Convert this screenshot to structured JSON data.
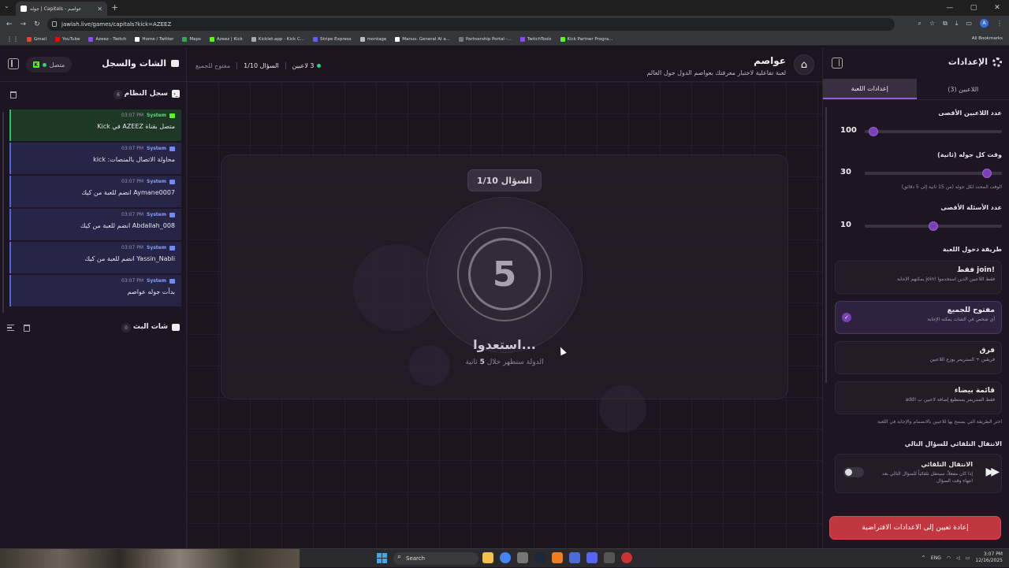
{
  "browser": {
    "tab_title": "جوله | Capitals - عواصم",
    "url": "jawlah.live/games/capitals?kick=AZEEZ",
    "bookmarks": [
      "Gmail",
      "YouTube",
      "Azeez - Twitch",
      "Home / Twitter",
      "Maps",
      "Azeez | Kick",
      "Kicklet.app - Kick C...",
      "Stripe Express",
      "montage",
      "Manus: General AI a...",
      "Partnership Portal -...",
      "TwitchTools",
      "Kick Partner Progra..."
    ],
    "all_bookmarks": "All Bookmarks",
    "avatar_letter": "A"
  },
  "left": {
    "title": "الشات والسجل",
    "connection": "متصل",
    "system_log_title": "سجل النظام",
    "system_log_count": "6",
    "logs": [
      {
        "source": "System",
        "time": "03:07 PM",
        "message": "متصل بقناة AZEEZ في Kick",
        "kind": "ok"
      },
      {
        "source": "System",
        "time": "03:07 PM",
        "message": "محاولة الاتصال بالمنصات: kick",
        "kind": "info"
      },
      {
        "source": "System",
        "time": "03:07 PM",
        "message": "Aymane0007 انضم للعبة من كيك",
        "kind": "info"
      },
      {
        "source": "System",
        "time": "03:07 PM",
        "message": "Abdallah_008 انضم للعبة من كيك",
        "kind": "info"
      },
      {
        "source": "System",
        "time": "03:07 PM",
        "message": "Yassin_Nabli انضم للعبة من كيك",
        "kind": "info"
      },
      {
        "source": "System",
        "time": "03:07 PM",
        "message": "بدأت جوله عواصم",
        "kind": "info"
      }
    ],
    "chat_title": "شات البث",
    "chat_count": "0"
  },
  "game": {
    "title": "عواصم",
    "subtitle": "لعبة تفاعلية لاختبار معرفتك بعواصم الدول حول العالم",
    "players_status": "3 لاعبين",
    "question_status": "السؤال 1/10",
    "mode_status": "مفتوح للجميع",
    "question_pill": "السؤال 1/10",
    "countdown": "5",
    "ready_text": "استعدوا...",
    "reveal_prefix": "الدولة ستظهر خلال",
    "reveal_num": "5",
    "reveal_suffix": "ثانية"
  },
  "settings": {
    "title": "الإعدادات",
    "tab_players": "اللاعبين (3)",
    "tab_game": "إعدادات اللعبة",
    "max_players_label": "عدد اللاعبين الأقصى",
    "max_players": "100",
    "max_players_fraction": 0.03,
    "round_time_label": "وقت كل جوله (ثانية)",
    "round_time": "30",
    "round_time_fraction": 0.92,
    "round_time_hint": "الوقت المحدد لكل جوله (من 15 ثانية إلى 5 دقائق)",
    "max_questions_label": "عدد الأسئلة الأقصى",
    "max_questions": "10",
    "max_questions_fraction": 0.5,
    "entry_method_label": "طريقة دخول اللعبة",
    "entry_options": [
      {
        "title": "!join فقط",
        "desc": "فقط اللاعبين الذين استخدموا !join يمكنهم الإجابة",
        "selected": false
      },
      {
        "title": "مفتوح للجميع",
        "desc": "أي شخص في الشات يمكنه الإجابة",
        "selected": true
      },
      {
        "title": "فرق",
        "desc": "فريقين + الستريمر يوزع اللاعبين",
        "selected": false
      },
      {
        "title": "قائمة بيضاء",
        "desc": "فقط الستريمر يستطيع إضافة لاعبين ب !add",
        "selected": false
      }
    ],
    "entry_hint": "اختر الطريقة التي يسمح بها للاعبين بالانضمام والإجابة في اللعبة",
    "auto_next_label": "الانتقال التلقائي للسؤال التالي",
    "auto_title": "الانتقال التلقائي",
    "auto_desc": "إذا كان مفعلاً، سينتقل تلقائياً للسؤال التالي بعد انتهاء وقت السؤال",
    "auto_enabled": false,
    "reset_button": "إعادة تعيين إلى الاعدادات الافتراضية"
  },
  "taskbar": {
    "search": "Search",
    "lang": "ENG",
    "time": "3:07 PM",
    "date": "12/16/2025"
  }
}
